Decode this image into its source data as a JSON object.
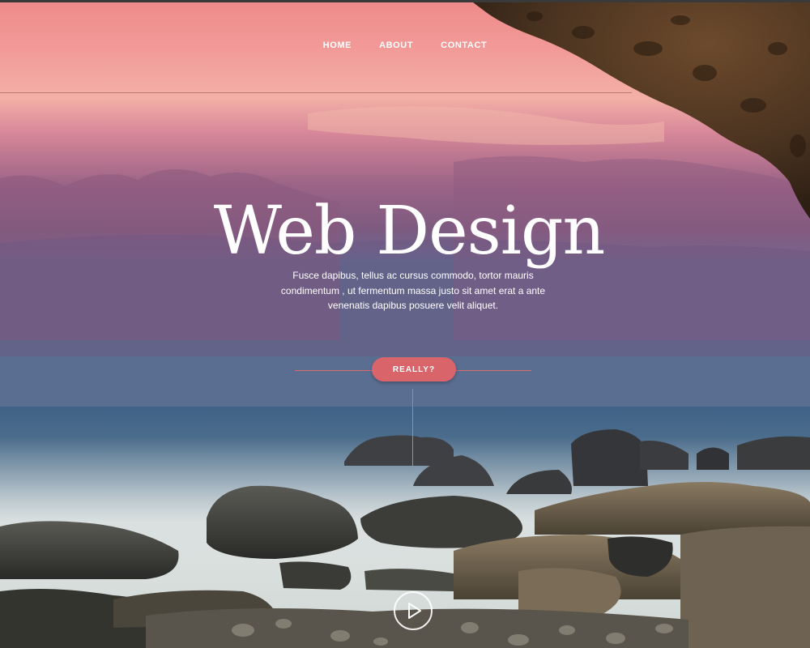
{
  "nav": {
    "items": [
      {
        "label": "HOME"
      },
      {
        "label": "ABOUT"
      },
      {
        "label": "CONTACT"
      }
    ]
  },
  "hero": {
    "title": "Web Design",
    "subtitle": "Fusce dapibus, tellus ac cursus commodo, tortor mauris condimentum , ut fermentum massa justo sit amet erat a ante venenatis dapibus posuere velit aliquet.",
    "cta_label": "REALLY?"
  },
  "icons": {
    "play": "play-icon"
  },
  "colors": {
    "accent": "#d9646a",
    "sky_top": "#f08a8a",
    "sky_mid": "#9a6088",
    "sea": "#4a6a8a"
  }
}
